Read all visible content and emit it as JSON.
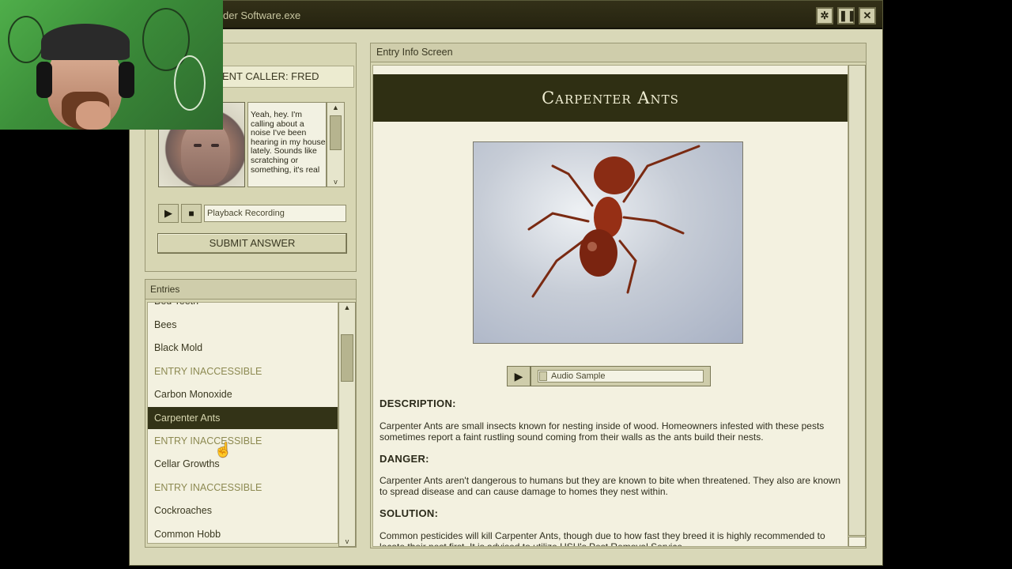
{
  "window": {
    "title": "der Software.exe",
    "buttons": {
      "settings_icon": "gear-icon",
      "pause_icon": "pause-icon",
      "close_icon": "close-icon"
    }
  },
  "caller": {
    "header": "ENT CALLER: FRED",
    "transcript": "Yeah, hey. I'm calling about a noise I've been hearing in my house lately. Sounds like scratching or something, it's real",
    "playback_label": "Playback Recording",
    "submit_label": "SUBMIT ANSWER"
  },
  "entries": {
    "header": "Entries",
    "partial_top": "Bed Teeth",
    "items": [
      {
        "label": "Bees",
        "state": "normal"
      },
      {
        "label": "Black Mold",
        "state": "normal"
      },
      {
        "label": "ENTRY INACCESSIBLE",
        "state": "inaccessible"
      },
      {
        "label": "Carbon Monoxide",
        "state": "normal"
      },
      {
        "label": "Carpenter Ants",
        "state": "selected"
      },
      {
        "label": "ENTRY INACCESSIBLE",
        "state": "inaccessible"
      },
      {
        "label": "Cellar Growths",
        "state": "normal"
      },
      {
        "label": "ENTRY INACCESSIBLE",
        "state": "inaccessible"
      },
      {
        "label": "Cockroaches",
        "state": "normal"
      },
      {
        "label": "Common Hobb",
        "state": "normal"
      }
    ]
  },
  "info": {
    "header": "Entry Info Screen",
    "title": "Carpenter Ants",
    "audio_label": "Audio Sample",
    "description_head": "DESCRIPTION:",
    "description": "Carpenter Ants are small insects known for nesting inside of wood. Homeowners infested with these pests sometimes report a faint rustling sound coming from their walls as the ants build their nests.",
    "danger_head": "DANGER:",
    "danger": "Carpenter Ants aren't dangerous to humans but they are known to bite when threatened. They also are known to spread disease and can cause damage to homes they nest within.",
    "solution_head": "SOLUTION:",
    "solution": "Common pesticides will kill Carpenter Ants, though due to how fast they breed it is highly recommended to locate their nest first. It is advised to utilize HSH's Pest Removal Service"
  },
  "colors": {
    "window_bg": "#d9d8b8",
    "titlebar": "#2a2814",
    "selected_row": "#333317",
    "inaccessible_text": "#8d8a52",
    "webcam_green": "#4fae4a"
  }
}
